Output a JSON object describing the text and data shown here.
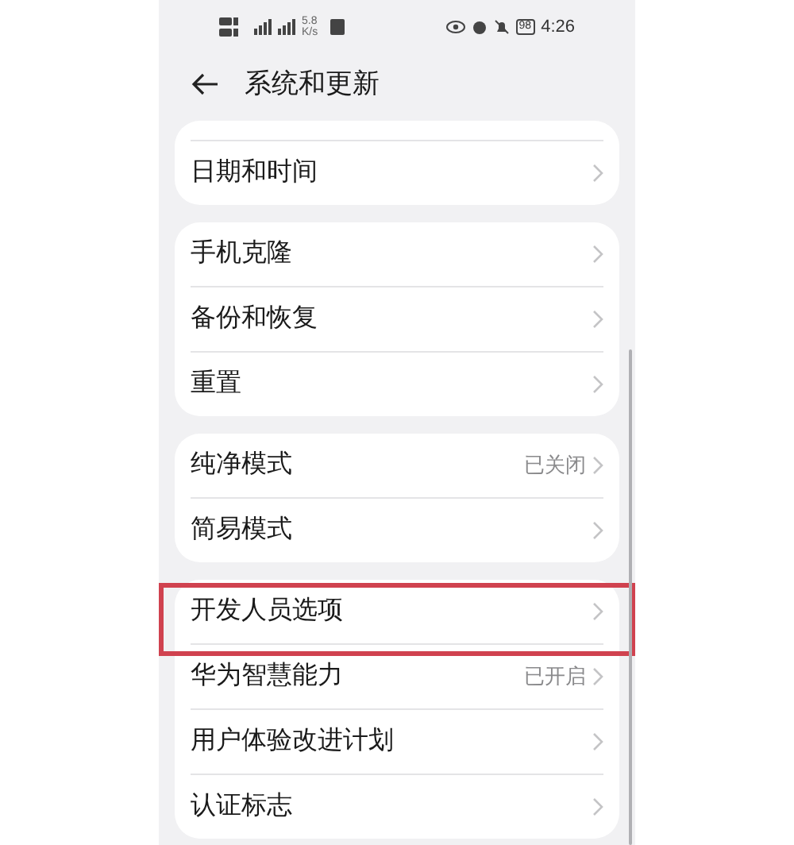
{
  "status_bar": {
    "speed_value": "5.8",
    "speed_unit": "K/s",
    "battery": "98",
    "time": "4:26"
  },
  "header": {
    "title": "系统和更新"
  },
  "groups": [
    {
      "leading_divider": true,
      "items": [
        {
          "label": "日期和时间",
          "highlighted": false
        }
      ]
    },
    {
      "leading_divider": false,
      "items": [
        {
          "label": "手机克隆",
          "highlighted": false
        },
        {
          "label": "备份和恢复",
          "highlighted": false
        },
        {
          "label": "重置",
          "highlighted": false
        }
      ]
    },
    {
      "leading_divider": false,
      "items": [
        {
          "label": "纯净模式",
          "value": "已关闭",
          "highlighted": false
        },
        {
          "label": "简易模式",
          "highlighted": false
        }
      ]
    },
    {
      "leading_divider": false,
      "items": [
        {
          "label": "开发人员选项",
          "highlighted": true
        },
        {
          "label": "华为智慧能力",
          "value": "已开启",
          "highlighted": false
        },
        {
          "label": "用户体验改进计划",
          "highlighted": false
        },
        {
          "label": "认证标志",
          "highlighted": false
        }
      ]
    }
  ]
}
